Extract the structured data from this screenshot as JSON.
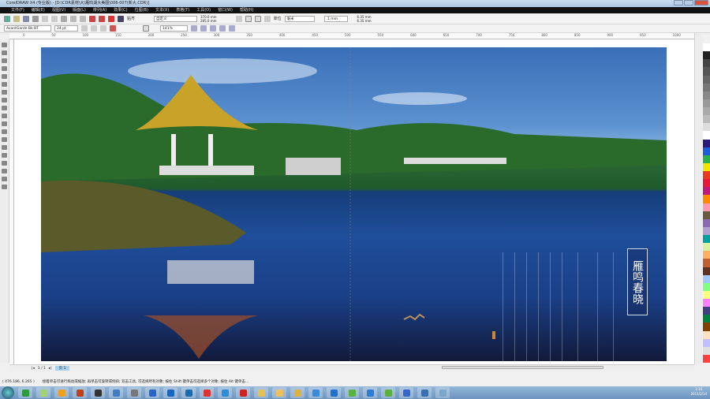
{
  "window": {
    "title": "CorelDRAW X4 (专业版) - [D:\\CDR素材\\大\\雁鸣湖大美图\\006-007(新大.CDR)]"
  },
  "menu": [
    "文件(F)",
    "编辑(E)",
    "视图(V)",
    "版面(L)",
    "排列(A)",
    "效果(C)",
    "位图(B)",
    "文本(X)",
    "表格(T)",
    "工具(O)",
    "窗口(W)",
    "帮助(H)"
  ],
  "toolbar": {
    "snap_label": "贴齐",
    "paper_preset": "自定义",
    "width": "370.0 mm",
    "height": "285.0 mm",
    "units_label": "单位",
    "units": "毫米",
    "nudge": ".1 mm",
    "dup_x": "6.35 mm",
    "dup_y": "6.35 mm"
  },
  "textbar": {
    "font": "AvantGarde Bk BT",
    "size": "24 pt",
    "zoom": "141%"
  },
  "ruler": [
    "0",
    "50",
    "100",
    "150",
    "200",
    "250",
    "300",
    "350",
    "400",
    "450",
    "500",
    "550",
    "600",
    "650",
    "700",
    "750",
    "800",
    "850",
    "900",
    "950",
    "1000"
  ],
  "pagenav": {
    "page": "1 / 1",
    "tab": "页 1"
  },
  "statusbar": {
    "coords": "( 476.186, 6.265 )",
    "hint": "接着单击可进行拖动或缩放; 再单击可旋转或倾斜; 双击工具, 可选择所有对象; 按住 Shift 键单击可选择多个对象; 按住 Alt 键单击..."
  },
  "artwork": {
    "title": "雁鸣春晓"
  },
  "taskbar": {
    "time": "1:10",
    "date": "2011/2/14",
    "icons": [
      "#2a9d3a",
      "#a5d36b",
      "#f0a020",
      "#c0401a",
      "#333",
      "#3d7ec4",
      "#777",
      "#2b62c9",
      "#1766c0",
      "#1a6bb0",
      "#d33",
      "#2a8fd8",
      "#d02020",
      "#e8c050",
      "#f0c060",
      "#e0b040",
      "#3a8ad8",
      "#2070d0",
      "#5ab040",
      "#2a7fd4",
      "#5bb040",
      "#3366cc",
      "#3a70b0",
      "#7aa8c8"
    ]
  },
  "palette": [
    "#ffffff",
    "#222222",
    "#444444",
    "#555555",
    "#666666",
    "#777777",
    "#888888",
    "#999999",
    "#aaaaaa",
    "#bbbbbb",
    "#dddddd",
    "#ffffff",
    "#2b1a7a",
    "#1e5ed8",
    "#2bb04a",
    "#f2e600",
    "#e83a1e",
    "#e8183a",
    "#c2187a",
    "#ff8a00",
    "#ff9ab0",
    "#6a5a40",
    "#8a6ab0",
    "#b0a0d0",
    "#00a0a0",
    "#d8f0a0",
    "#ffb060",
    "#c06030",
    "#603020",
    "#a0c8ff",
    "#80ff80",
    "#ffff80",
    "#ff80ff",
    "#404080",
    "#008040",
    "#804000",
    "#ffe0c0",
    "#c0c0ff",
    "#e0e0e0",
    "#ff4040"
  ]
}
